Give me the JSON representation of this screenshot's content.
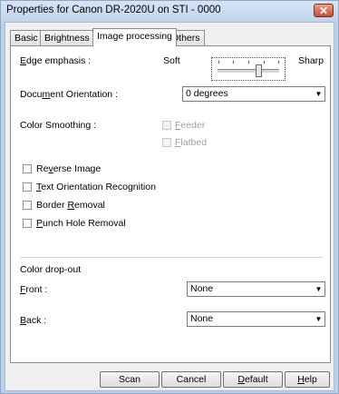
{
  "window": {
    "title": "Properties for Canon DR-2020U on STI - 0000",
    "close_glyph": "✕"
  },
  "tabs": [
    {
      "label": "Basic",
      "active": false
    },
    {
      "label": "Brightness",
      "active": false
    },
    {
      "label": "Image processing",
      "active": true
    },
    {
      "label": "Others",
      "active": false
    }
  ],
  "edge_emphasis": {
    "label_prefix": "E",
    "label_rest": "dge emphasis :",
    "min_label": "Soft",
    "max_label": "Sharp",
    "level_fraction": 0.67
  },
  "document_orientation": {
    "label_pre": "Docu",
    "label_u": "m",
    "label_post": "ent Orientation :",
    "value": "0 degrees"
  },
  "color_smoothing": {
    "label": "Color Smoothing :",
    "feeder_u": "F",
    "feeder_rest": "eeder",
    "flatbed_u": "F",
    "flatbed_rest": "latbed"
  },
  "options": {
    "reverse_pre": "Re",
    "reverse_u": "v",
    "reverse_post": "erse Image",
    "text_orient_u": "T",
    "text_orient_post": "ext Orientation Recognition",
    "border_pre": "Border ",
    "border_u": "R",
    "border_post": "emoval",
    "punch_u": "P",
    "punch_post": "unch Hole Removal"
  },
  "color_dropout": {
    "heading": "Color drop-out",
    "front_u": "F",
    "front_rest": "ront :",
    "front_value": "None",
    "back_u": "B",
    "back_rest": "ack :",
    "back_value": "None"
  },
  "buttons": {
    "scan": "Scan",
    "cancel": "Cancel",
    "default_u": "D",
    "default_rest": "efault",
    "help_u": "H",
    "help_rest": "elp"
  },
  "icons": {
    "dropdown_arrow": "▼"
  },
  "colors": {
    "title_bar": "#c2d5ee",
    "close_button": "#c74a30",
    "panel_bg": "#ffffff",
    "dialog_bg": "#f0f0f0"
  }
}
